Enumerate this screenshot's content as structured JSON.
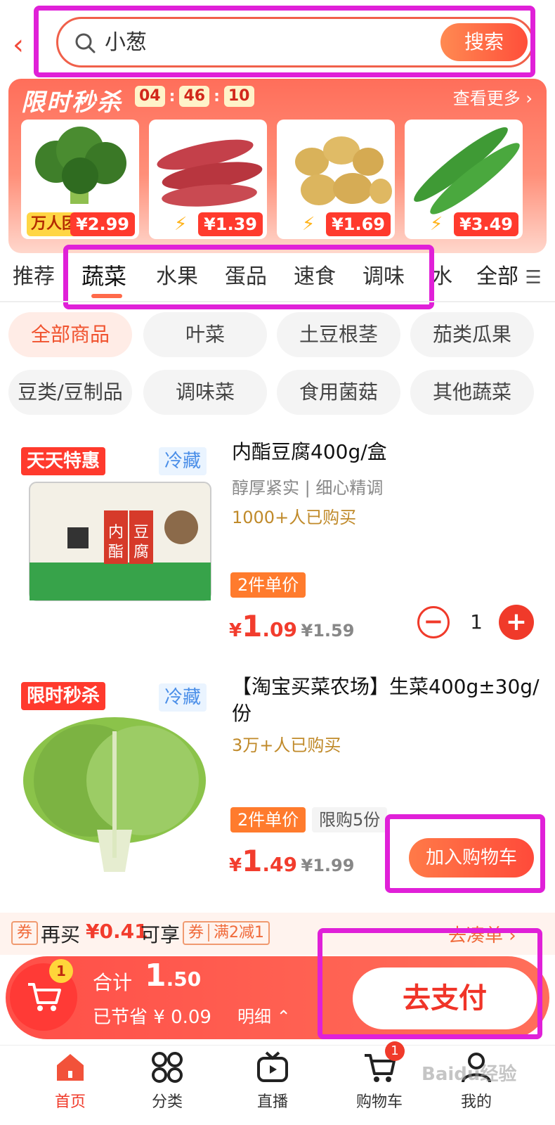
{
  "search": {
    "query": "小葱",
    "button": "搜索"
  },
  "flash_sale": {
    "title": "限时秒杀",
    "timer": [
      "04",
      "46",
      "10"
    ],
    "more": "查看更多 ›",
    "items": [
      {
        "name": "broccoli",
        "tag": "万人团",
        "price": "¥2.99"
      },
      {
        "name": "sweet-potato",
        "tag": "",
        "price": "¥1.39"
      },
      {
        "name": "potato",
        "tag": "",
        "price": "¥1.69"
      },
      {
        "name": "bitter-melon",
        "tag": "",
        "price": "¥3.49"
      }
    ]
  },
  "tabs": {
    "items": [
      "推荐",
      "蔬菜",
      "水果",
      "蛋品",
      "速食",
      "调味",
      "水"
    ],
    "active": "蔬菜",
    "all": "全部"
  },
  "chips": [
    "全部商品",
    "叶菜",
    "土豆根茎",
    "茄类瓜果",
    "豆类/豆制品",
    "调味菜",
    "食用菌菇",
    "其他蔬菜"
  ],
  "products": [
    {
      "badge": "天天特惠",
      "cold": "冷藏",
      "title": "内酯豆腐400g/盒",
      "subtitle": "醇厚紧实 | 细心精调",
      "sold": "1000+人已购买",
      "unit": "2件单价",
      "price_int": "1",
      "price_dec": ".09",
      "currency": "¥",
      "orig": "¥1.59",
      "qty": "1"
    },
    {
      "badge": "限时秒杀",
      "cold": "冷藏",
      "title": "【淘宝买菜农场】生菜400g±30g/份",
      "sold": "3万+人已购买",
      "unit": "2件单价",
      "limit": "限购5份",
      "price_int": "1",
      "price_dec": ".49",
      "currency": "¥",
      "orig": "¥1.99",
      "add": "加入购物车"
    }
  ],
  "coupon": {
    "tag": "券",
    "text1": "再买",
    "amount": "¥0.41",
    "text2": "可享",
    "box_tag": "券",
    "box_text": "满2减1",
    "link": "去凑单 ›"
  },
  "checkout": {
    "badge": "1",
    "total_label": "合计",
    "total_int": "1",
    "total_dec": ".50",
    "saved": "已节省 ¥ 0.09",
    "detail": "明细 ⌃",
    "pay": "去支付"
  },
  "nav": [
    {
      "label": "首页",
      "icon": "home-icon"
    },
    {
      "label": "分类",
      "icon": "category-icon"
    },
    {
      "label": "直播",
      "icon": "live-icon"
    },
    {
      "label": "购物车",
      "icon": "cart-icon",
      "badge": "1"
    },
    {
      "label": "我的",
      "icon": "profile-icon"
    }
  ],
  "watermark": "Baidu经验",
  "colors": {
    "accent": "#ff4e3a",
    "highlight": "#e020d8"
  }
}
